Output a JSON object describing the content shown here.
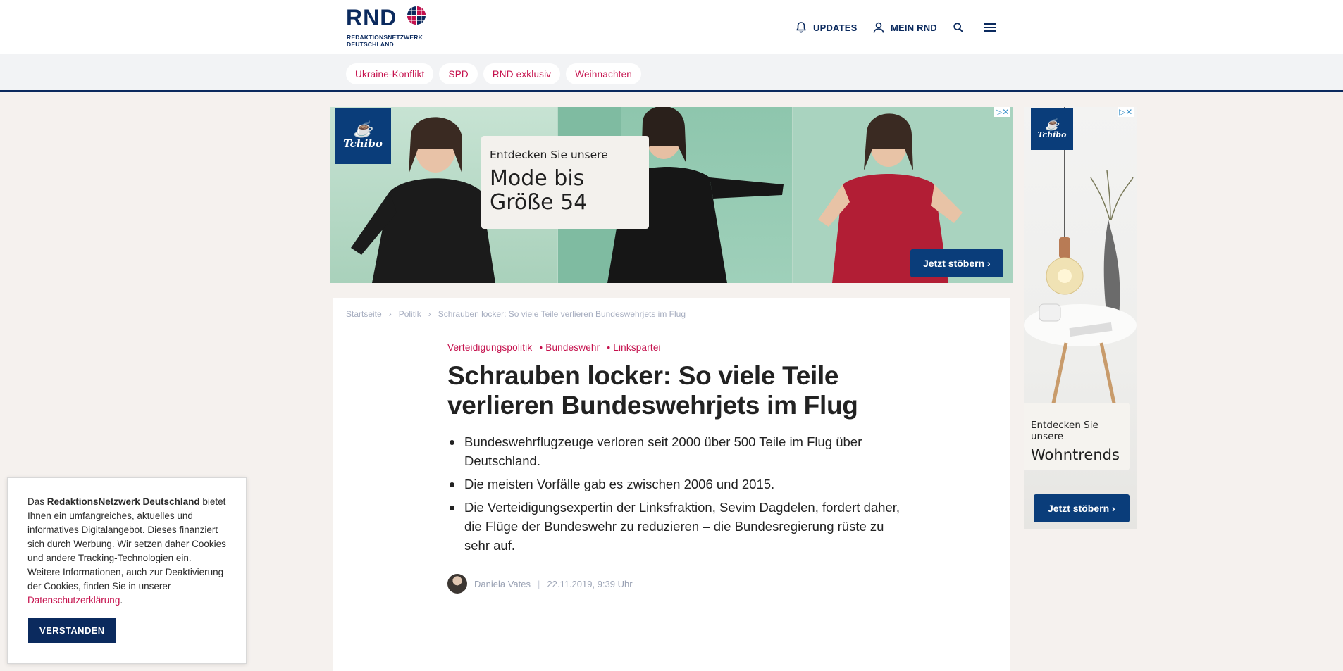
{
  "header": {
    "logo_text": "RND",
    "logo_sub_1": "REDAKTIONSNETZWERK",
    "logo_sub_2": "DEUTSCHLAND",
    "nav": {
      "updates": "UPDATES",
      "mein_rnd": "MEIN RND"
    },
    "icons": [
      "bell-icon",
      "user-icon",
      "search-icon",
      "menu-icon"
    ],
    "brand_color": "#0b2a5e"
  },
  "tags": [
    "Ukraine-Konflikt",
    "SPD",
    "RND exklusiv",
    "Weihnachten"
  ],
  "tag_color": "#c5114d",
  "ad_banner": {
    "brand": "Tchibo",
    "promo_small": "Entdecken Sie unsere",
    "promo_big_line1": "Mode bis",
    "promo_big_line2": "Größe 54",
    "cta": "Jetzt stöbern ›"
  },
  "ad_side": {
    "brand": "Tchibo",
    "promo_small": "Entdecken Sie unsere",
    "promo_big": "Wohntrends",
    "cta": "Jetzt stöbern ›"
  },
  "article": {
    "breadcrumb": [
      "Startseite",
      "Politik",
      "Schrauben locker: So viele Teile verlieren Bundeswehrjets im Flug"
    ],
    "categories": [
      "Verteidigungspolitik",
      "Bundeswehr",
      "Linkspartei"
    ],
    "headline": "Schrauben locker: So viele Teile verlieren Bundeswehrjets im Flug",
    "bullets": [
      "Bundeswehrflugzeuge verloren seit 2000 über 500 Teile im Flug über Deutschland.",
      "Die meisten Vorfälle gab es zwischen 2006 und 2015.",
      "Die Verteidigungsexpertin der Linksfraktion, Sevim Dagdelen, fordert daher, die Flüge der Bundeswehr zu reduzieren – die Bundesregierung rüste zu sehr auf."
    ],
    "author": "Daniela Vates",
    "date": "22.11.2019, 9:39 Uhr"
  },
  "cookie": {
    "text_before": "Das ",
    "brand": "RedaktionsNetzwerk Deutschland",
    "text_after": " bietet Ihnen ein umfangreiches, aktuelles und informatives Digitalangebot. Dieses finanziert sich durch Werbung. Wir setzen daher Cookies und andere Tracking-Technologien ein. Weitere Informationen, auch zur Deaktivierung der Cookies, finden Sie in unserer ",
    "link": "Datenschutzerklärung",
    "text_end": ".",
    "button": "VERSTANDEN"
  }
}
